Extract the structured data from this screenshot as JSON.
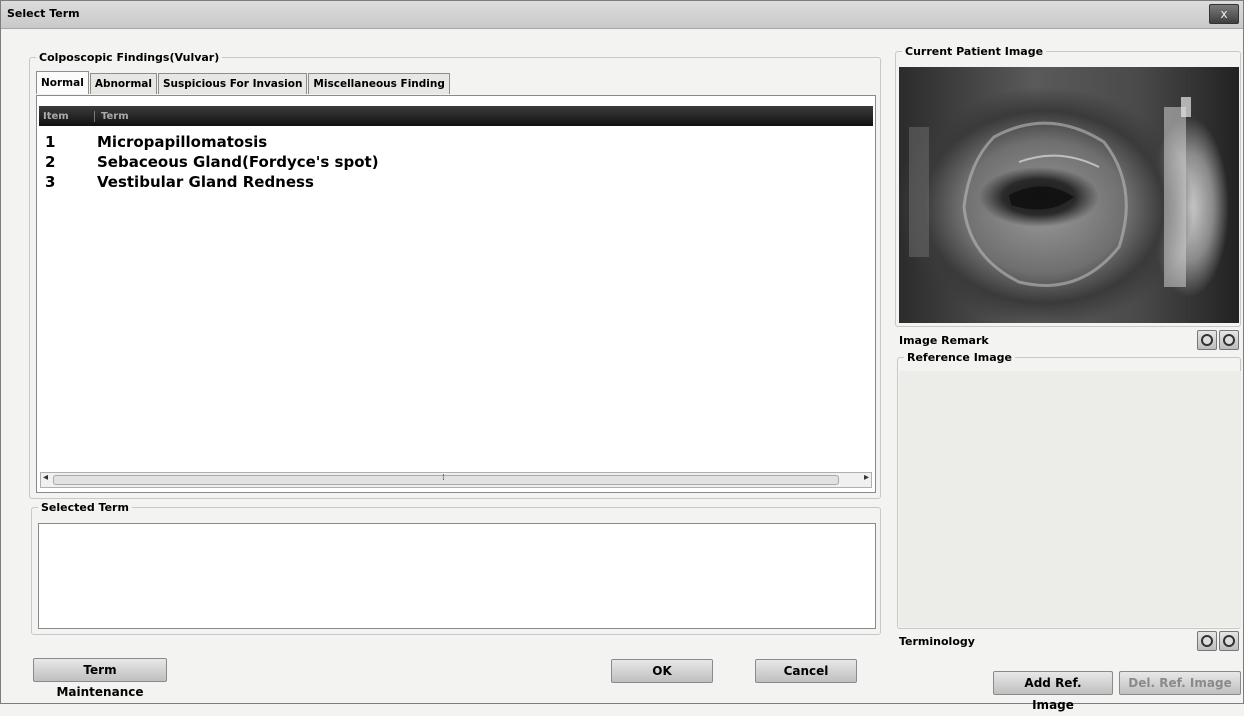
{
  "window": {
    "title": "Select Term",
    "close_label": "x"
  },
  "findings": {
    "legend": "Colposcopic Findings(Vulvar)",
    "tabs": [
      {
        "label": "Normal",
        "active": true
      },
      {
        "label": "Abnormal",
        "active": false
      },
      {
        "label": "Suspicious For Invasion",
        "active": false
      },
      {
        "label": "Miscellaneous Finding",
        "active": false
      }
    ],
    "columns": {
      "item": "Item",
      "term": "Term"
    },
    "rows": [
      {
        "num": "1",
        "term": "Micropapillomatosis"
      },
      {
        "num": "2",
        "term": "Sebaceous Gland(Fordyce's spot)"
      },
      {
        "num": "3",
        "term": "Vestibular Gland Redness"
      }
    ]
  },
  "selected_term": {
    "legend": "Selected Term",
    "value": ""
  },
  "buttons": {
    "term_maintenance": "Term Maintenance",
    "ok": "OK",
    "cancel": "Cancel",
    "add_ref_image": "Add Ref. Image",
    "del_ref_image": "Del. Ref. Image"
  },
  "right_panel": {
    "current_patient_image": "Current Patient Image",
    "image_remark": "Image Remark",
    "reference_image": "Reference Image",
    "terminology": "Terminology"
  },
  "icons": {
    "close": "close-icon",
    "prev": "circle-prev-icon",
    "next": "circle-next-icon",
    "scroll_left": "scroll-left-icon",
    "scroll_right": "scroll-right-icon"
  },
  "colors": {
    "header_bg": "#1a1a1a",
    "window_bg": "#f3f3f1"
  }
}
